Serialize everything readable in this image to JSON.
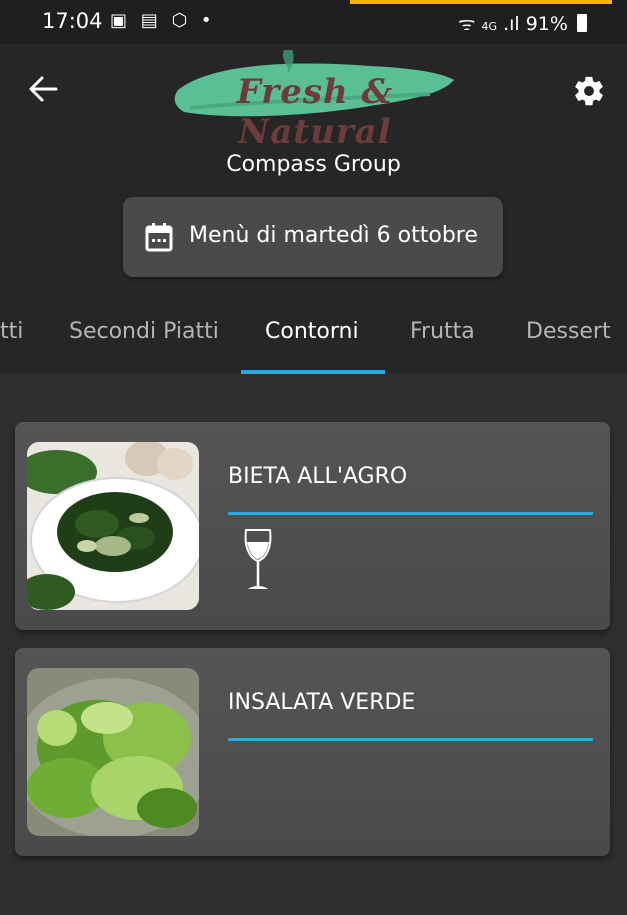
{
  "status_bar": {
    "time": "17:04",
    "network": "4G",
    "battery": "91%"
  },
  "header": {
    "logo_text": "Fresh & Natural",
    "company": "Compass Group",
    "date_button": "Menù di martedì 6 ottobre"
  },
  "tabs": [
    {
      "label": "tti"
    },
    {
      "label": "Secondi Piatti"
    },
    {
      "label": "Contorni",
      "active": true
    },
    {
      "label": "Frutta"
    },
    {
      "label": "Dessert"
    }
  ],
  "dishes": [
    {
      "name": "BIETA ALL'AGRO",
      "icon": "wine-glass-icon"
    },
    {
      "name": "INSALATA VERDE"
    }
  ],
  "colors": {
    "accent": "#29a9e0",
    "header_bg": "#262626",
    "content_bg": "#2f2f2f",
    "card_bg": "#4e4e4e",
    "logo_brush": "#5bbf95",
    "logo_text": "#6e3b3b"
  }
}
